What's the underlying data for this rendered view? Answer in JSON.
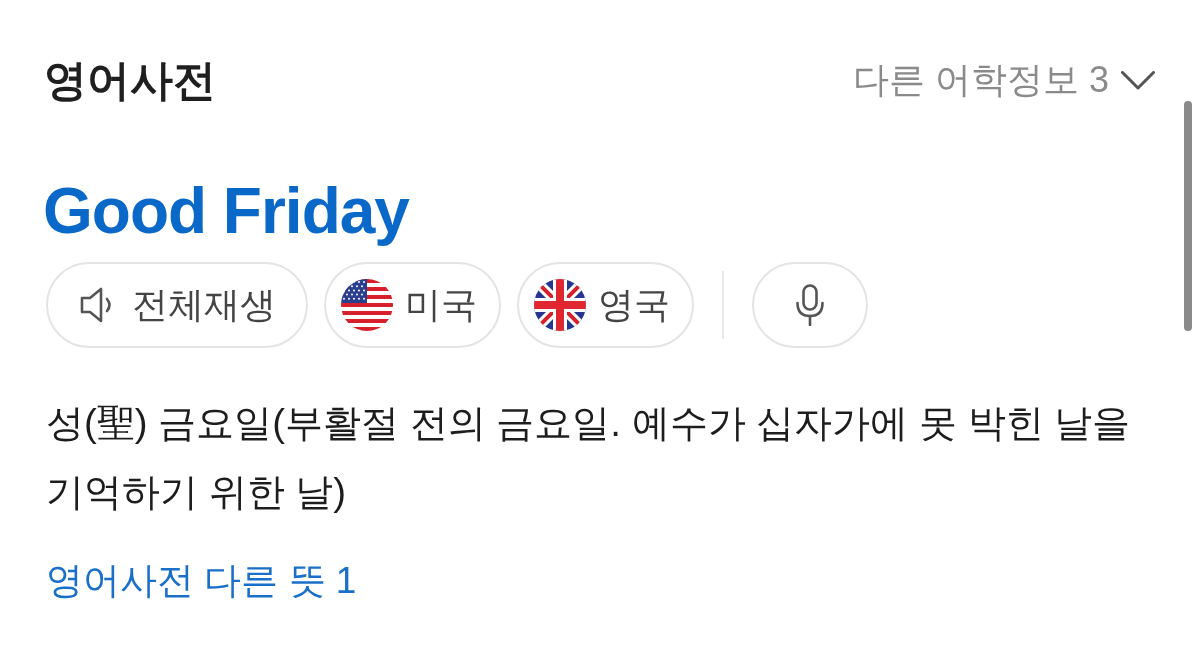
{
  "header": {
    "title": "영어사전",
    "more_info": {
      "label": "다른 어학정보 3",
      "expanded": false
    }
  },
  "entry": {
    "headword": "Good Friday"
  },
  "audio_buttons": [
    {
      "kind": "speaker",
      "label": "전체재생"
    },
    {
      "kind": "us_flag",
      "label": "미국"
    },
    {
      "kind": "uk_flag",
      "label": "영국"
    },
    {
      "kind": "mic"
    }
  ],
  "definition": "성(聖) 금요일(부활절 전의 금요일. 예수가 십자가에 못 박힌 날을 기억하기 위한 날)",
  "more_meanings_link": "영어사전 다른 뜻 1"
}
